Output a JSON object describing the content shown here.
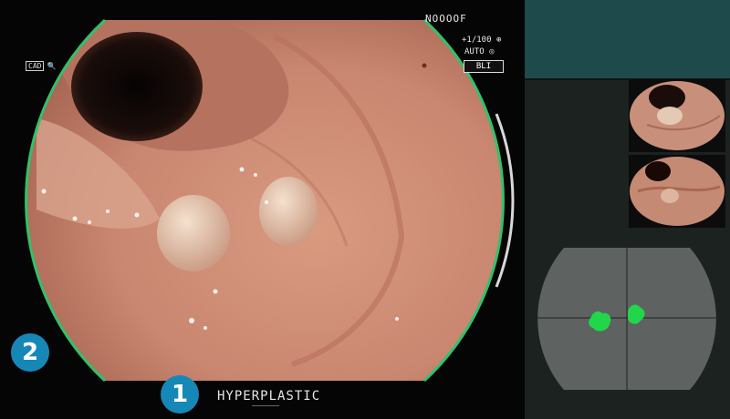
{
  "endoscope": {
    "scope_id": "NOOOOF",
    "zoom_readout": "+1/100",
    "auto_label": "AUTO",
    "mode_label": "BLI",
    "cad_label": "CAD"
  },
  "diagnosis": {
    "label": "HYPERPLASTIC"
  },
  "markers": {
    "one": "1",
    "two": "2"
  },
  "colors": {
    "ring_green": "#2fc26a",
    "marker_blue": "#1688b8",
    "lesion_green": "#22d64a",
    "side_top_teal": "#1f4a4b"
  },
  "icons": [
    "magnify-icon",
    "circle-icon"
  ]
}
